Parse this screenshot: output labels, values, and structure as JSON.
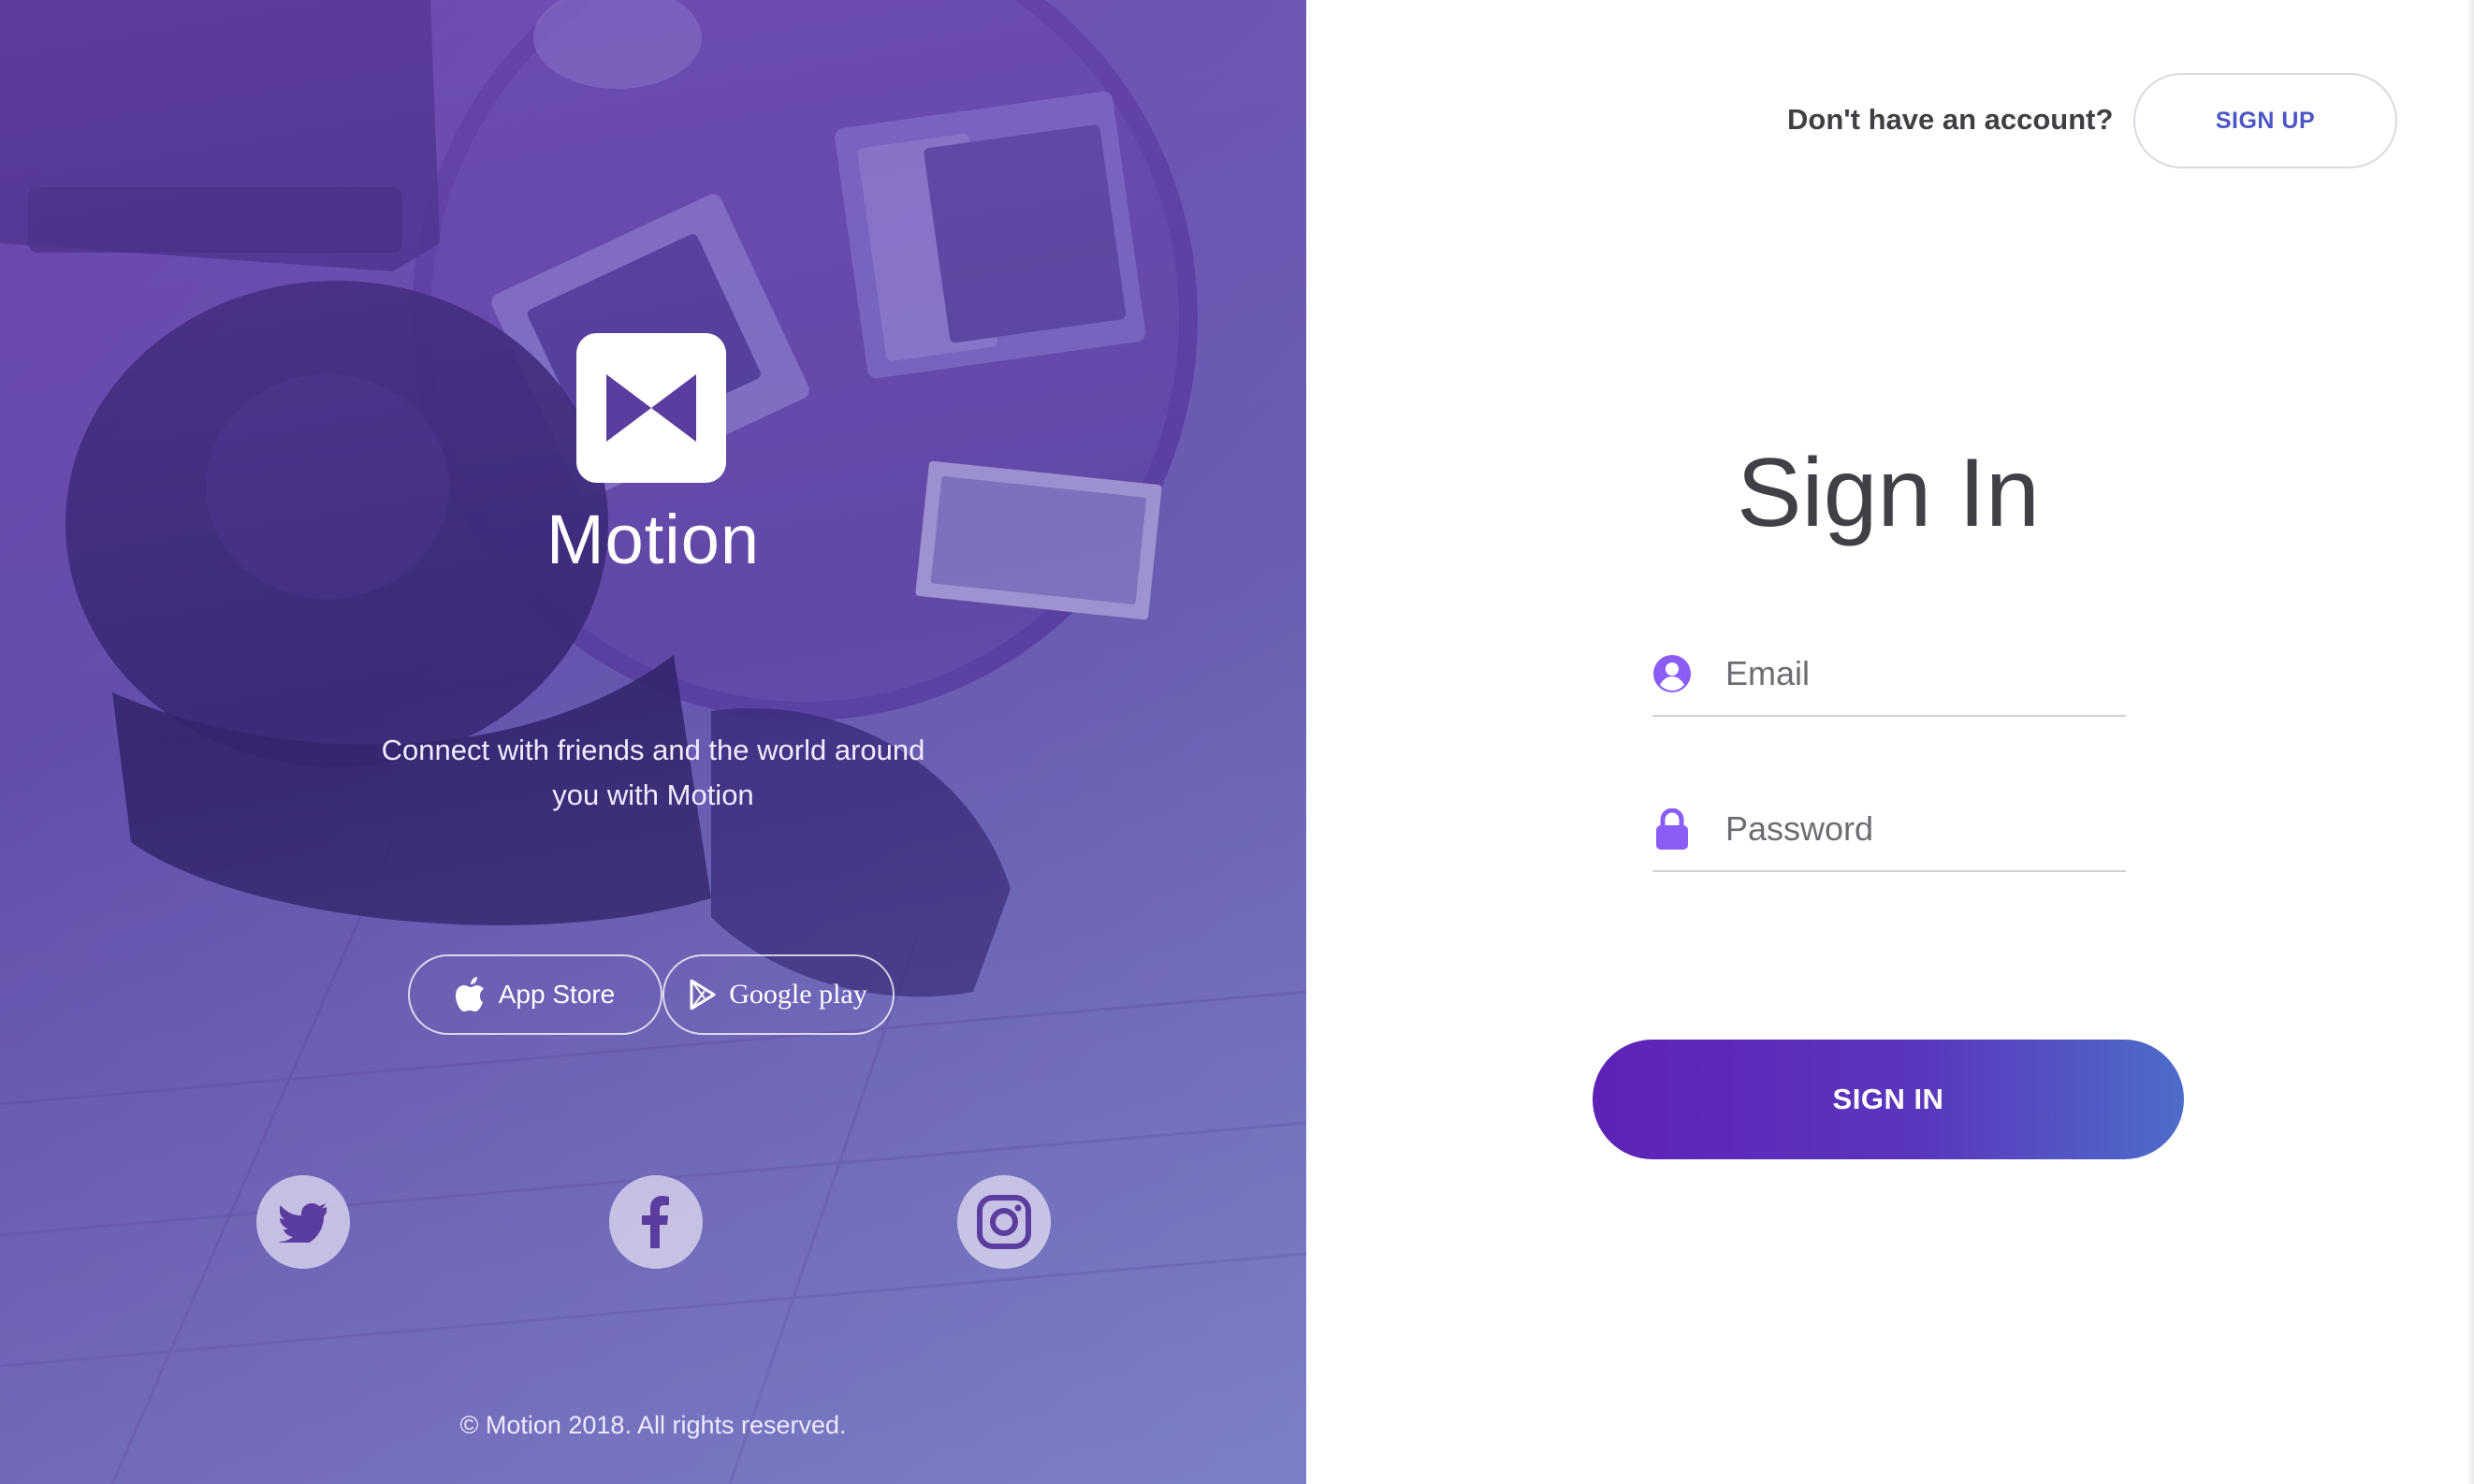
{
  "brand": {
    "name": "Motion",
    "tagline": "Connect with friends and the world around you with Motion",
    "copyright": "© Motion 2018. All rights reserved."
  },
  "stores": {
    "apple_label": "App Store",
    "google_label": "Google play"
  },
  "social": [
    {
      "name": "twitter-icon"
    },
    {
      "name": "facebook-icon"
    },
    {
      "name": "instagram-icon"
    }
  ],
  "header": {
    "account_prompt": "Don't have an account?",
    "signup_label": "SIGN UP"
  },
  "form": {
    "title": "Sign In",
    "email_placeholder": "Email",
    "email_value": "",
    "password_placeholder": "Password",
    "password_value": "",
    "submit_label": "SIGN IN"
  },
  "colors": {
    "accent": "#5e22b6",
    "accent_end": "#4d6dca",
    "link": "#4b55c4",
    "icon": "#8b5cf6"
  }
}
